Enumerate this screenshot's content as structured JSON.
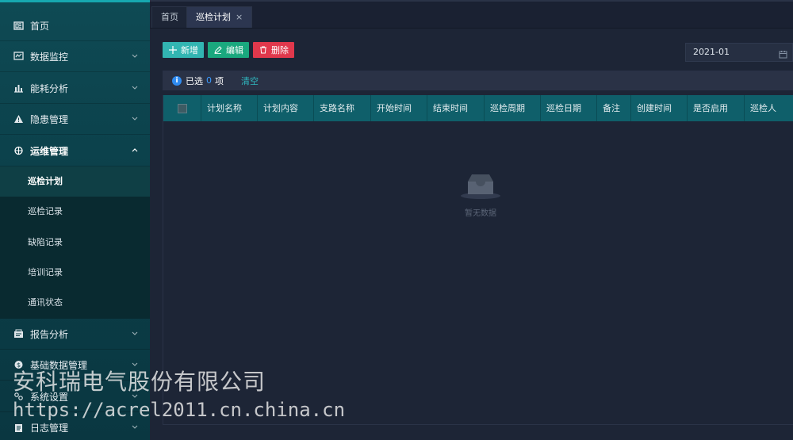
{
  "sidebar": {
    "items": [
      {
        "label": "首页",
        "icon": "home-icon"
      },
      {
        "label": "数据监控",
        "icon": "monitor-icon"
      },
      {
        "label": "能耗分析",
        "icon": "bar-chart-icon"
      },
      {
        "label": "隐患管理",
        "icon": "warning-icon"
      },
      {
        "label": "运维管理",
        "icon": "maintenance-icon"
      },
      {
        "label": "报告分析",
        "icon": "report-icon"
      },
      {
        "label": "基础数据管理",
        "icon": "database-icon"
      },
      {
        "label": "系统设置",
        "icon": "settings-icon"
      },
      {
        "label": "日志管理",
        "icon": "log-icon"
      }
    ],
    "submenu": [
      {
        "label": "巡检计划"
      },
      {
        "label": "巡检记录"
      },
      {
        "label": "缺陷记录"
      },
      {
        "label": "培训记录"
      },
      {
        "label": "通讯状态"
      }
    ]
  },
  "tabs": [
    {
      "label": "首页"
    },
    {
      "label": "巡检计划",
      "close": "×"
    }
  ],
  "toolbar": {
    "add_label": "新增",
    "edit_label": "编辑",
    "delete_label": "删除",
    "date_value": "2021-01"
  },
  "selection": {
    "prefix": "已选",
    "count": "0",
    "suffix": "项",
    "clear_label": "清空"
  },
  "table": {
    "columns": [
      "计划名称",
      "计划内容",
      "支路名称",
      "开始时间",
      "结束时间",
      "巡检周期",
      "巡检日期",
      "备注",
      "创建时间",
      "是否启用",
      "巡检人"
    ],
    "empty_text": "暂无数据"
  },
  "watermark": {
    "line1": "安科瑞电气股份有限公司",
    "line2": "https://acrel2011.cn.china.cn"
  },
  "colors": {
    "accent": "#17a8b0",
    "add": "#32b5b2",
    "edit": "#1aa87e",
    "delete": "#e0384c",
    "table_header": "#0f5f6a"
  }
}
